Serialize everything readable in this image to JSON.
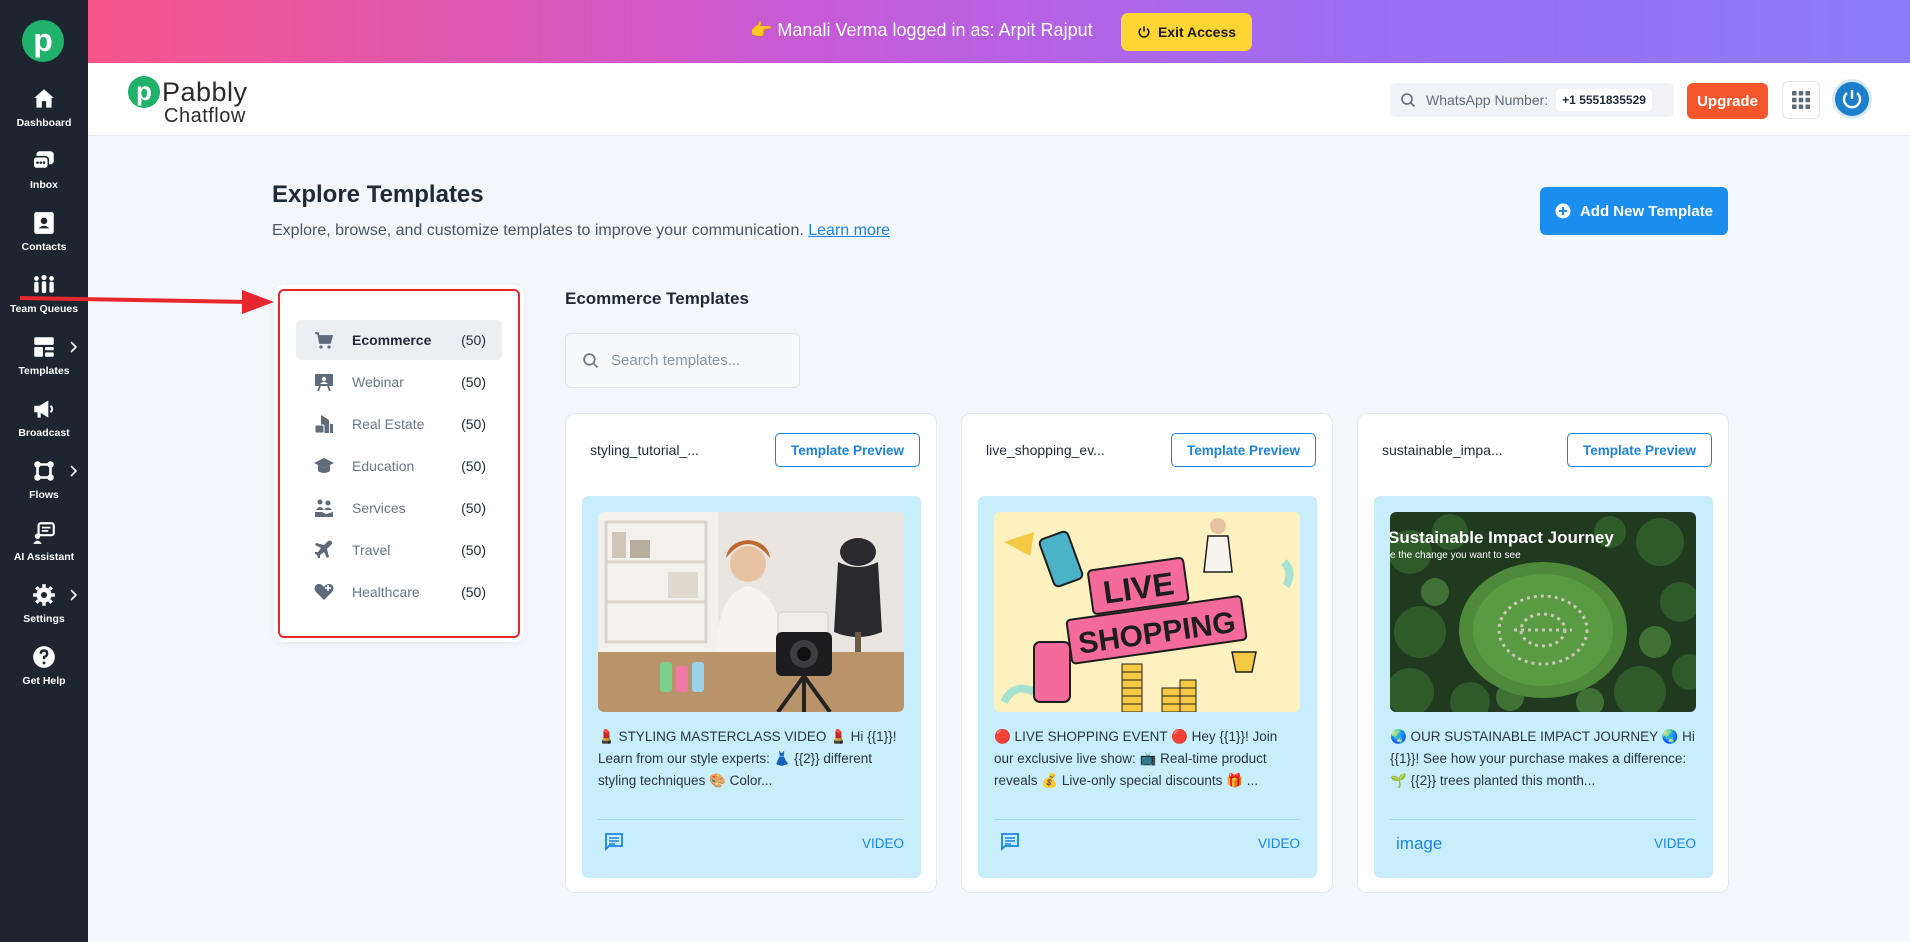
{
  "banner": {
    "message": "👉 Manali Verma logged in as: Arpit Rajput",
    "exit_label": "Exit Access"
  },
  "sidebar": {
    "items": [
      {
        "label": "Dashboard",
        "icon": "home-icon"
      },
      {
        "label": "Inbox",
        "icon": "chat-icon"
      },
      {
        "label": "Contacts",
        "icon": "contact-card-icon"
      },
      {
        "label": "Team Queues",
        "icon": "team-icon"
      },
      {
        "label": "Templates",
        "icon": "template-icon"
      },
      {
        "label": "Broadcast",
        "icon": "megaphone-icon"
      },
      {
        "label": "Flows",
        "icon": "flow-icon"
      },
      {
        "label": "AI Assistant",
        "icon": "ai-assistant-icon"
      },
      {
        "label": "Settings",
        "icon": "gear-icon"
      },
      {
        "label": "Get Help",
        "icon": "help-icon"
      }
    ]
  },
  "header": {
    "brand_name": "Pabbly",
    "brand_sub": "Chatflow",
    "whatsapp_label": "WhatsApp Number:",
    "whatsapp_number": "+1 5551835529",
    "upgrade_label": "Upgrade"
  },
  "page": {
    "title": "Explore Templates",
    "subtitle": "Explore, browse, and customize templates to improve your communication.",
    "learn_more": "Learn more",
    "add_button": "Add New Template"
  },
  "categories": [
    {
      "name": "Ecommerce",
      "count": "(50)",
      "icon": "cart-icon",
      "active": true
    },
    {
      "name": "Webinar",
      "count": "(50)",
      "icon": "webinar-icon",
      "active": false
    },
    {
      "name": "Real Estate",
      "count": "(50)",
      "icon": "real-estate-icon",
      "active": false
    },
    {
      "name": "Education",
      "count": "(50)",
      "icon": "graduation-cap-icon",
      "active": false
    },
    {
      "name": "Services",
      "count": "(50)",
      "icon": "services-icon",
      "active": false
    },
    {
      "name": "Travel",
      "count": "(50)",
      "icon": "airplane-icon",
      "active": false
    },
    {
      "name": "Healthcare",
      "count": "(50)",
      "icon": "heart-plus-icon",
      "active": false
    }
  ],
  "templates": {
    "section_title": "Ecommerce Templates",
    "search_placeholder": "Search templates...",
    "preview_label": "Template Preview",
    "cards": [
      {
        "name": "styling_tutorial_...",
        "text": "💄 STYLING MASTERCLASS VIDEO 💄 Hi {{1}}! Learn from our style experts: 👗 {{2}} different styling techniques 🎨 Color...",
        "footer_icon": "message-icon",
        "footer_type": "VIDEO"
      },
      {
        "name": "live_shopping_ev...",
        "text": "🔴 LIVE SHOPPING EVENT 🔴 Hey {{1}}! Join our exclusive live show: 📺 Real-time product reveals 💰 Live-only special discounts 🎁 ...",
        "image_text": "LIVE SHOPPING",
        "footer_icon": "message-icon",
        "footer_type": "VIDEO"
      },
      {
        "name": "sustainable_impa...",
        "text": "🌏 OUR SUSTAINABLE IMPACT JOURNEY 🌏 Hi {{1}}! See how your purchase makes a difference: 🌱 {{2}} trees planted this month...",
        "image_title": "Sustainable Impact Journey",
        "image_subtitle": "e the change you want to see",
        "footer_label": "image",
        "footer_type": "VIDEO"
      }
    ]
  },
  "colors": {
    "sidebar_bg": "#1c2530",
    "accent_blue": "#1a8ff0",
    "upgrade_orange": "#f6562c",
    "exit_yellow": "#fcd535",
    "highlight_red": "#e8262d",
    "card_inner_bg": "#c8eefc"
  }
}
